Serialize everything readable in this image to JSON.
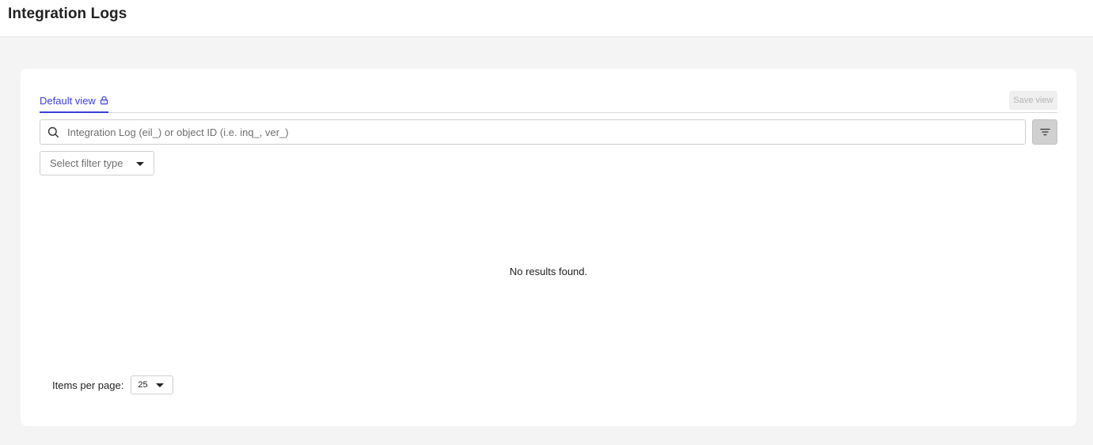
{
  "header": {
    "title": "Integration Logs"
  },
  "views": {
    "active_tab": "Default view",
    "tab_icon": "lock-icon",
    "save_label": "Save view"
  },
  "search": {
    "value": "",
    "placeholder": "Integration Log (eil_) or object ID (i.e. inq_, ver_)",
    "icon": "search-icon"
  },
  "filter_button": {
    "icon": "filter-icon"
  },
  "filter_type": {
    "placeholder": "Select filter type"
  },
  "results": {
    "empty_message": "No results found."
  },
  "pagination": {
    "items_per_page_label": "Items per page:",
    "items_per_page_value": "25"
  },
  "colors": {
    "accent": "#3b3fd8",
    "page_background": "#f4f4f4",
    "card_background": "#ffffff"
  }
}
